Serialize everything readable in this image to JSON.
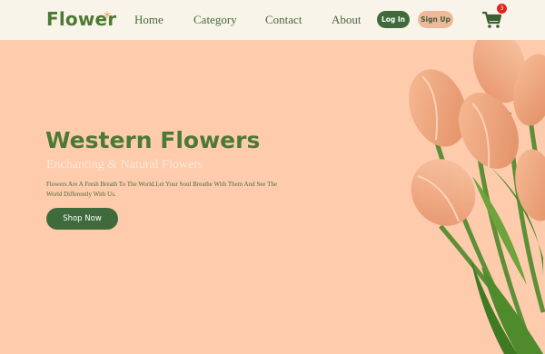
{
  "nav": {
    "logo": "Flower",
    "logo_star": "*",
    "links": [
      "Home",
      "Category",
      "Contact",
      "About"
    ],
    "login_label": "Log In",
    "signup_label": "Sign Up",
    "cart_icon": "cart-icon",
    "cart_count": "3"
  },
  "hero": {
    "title": "Western Flowers",
    "subtitle": "Enchanting & Natural Flowers",
    "description": "Flowers Are A Fresh Breath To The World.Let Your Soul Breathe With Them And See The World Differently With Us.",
    "cta_label": "Shop Now",
    "image": "tulip-bouquet-image"
  },
  "colors": {
    "background": "#fecbad",
    "navbar": "#f9f4e9",
    "brand_green": "#4c7a34",
    "button_green": "#3f6b3c",
    "signup_peach": "#f0b89a",
    "badge_red": "#e0241f",
    "tulip": "#f2a57c"
  }
}
